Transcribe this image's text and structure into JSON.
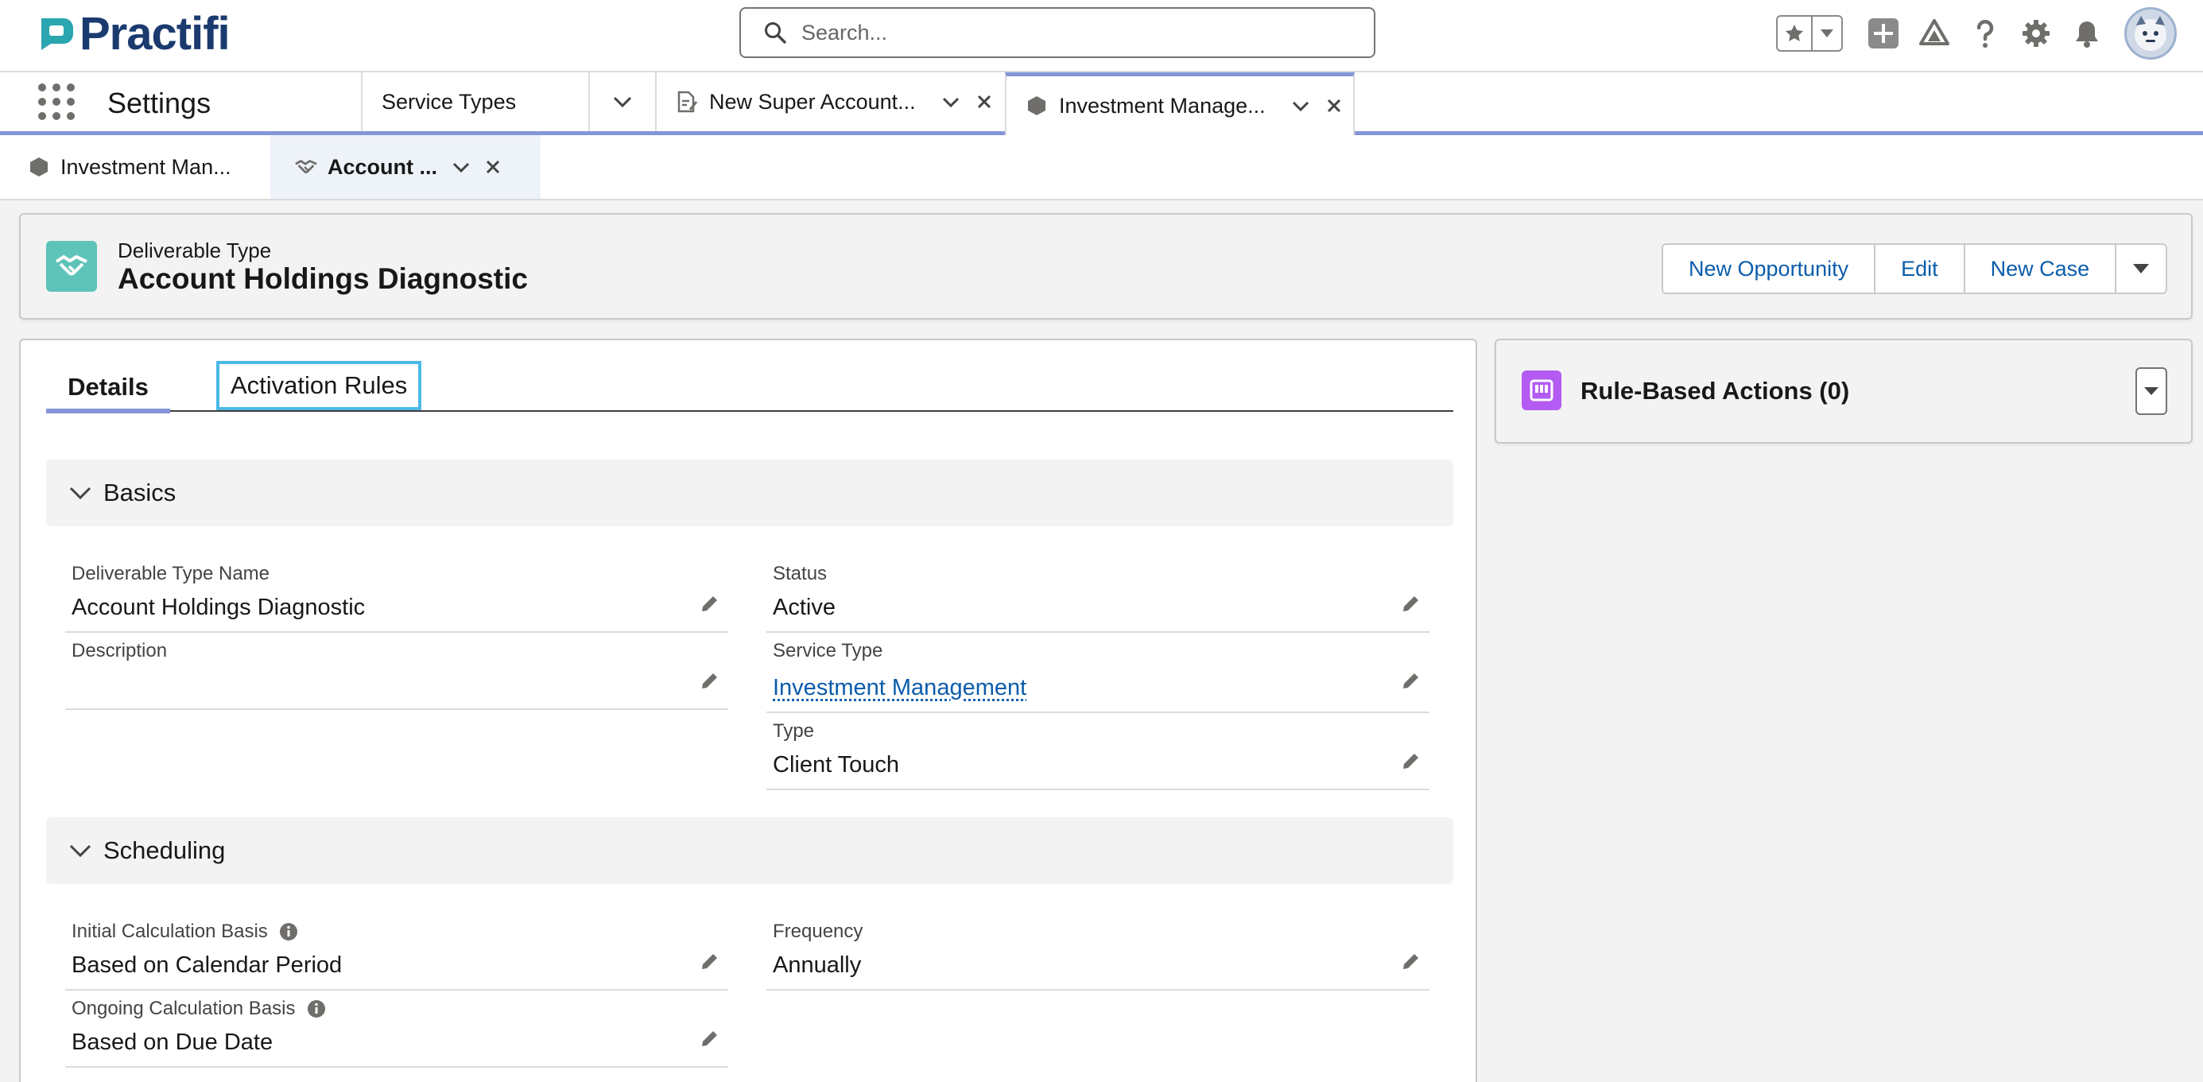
{
  "brand": {
    "name": "Practifi"
  },
  "search": {
    "placeholder": "Search..."
  },
  "header_icons": [
    "favorites-star-icon",
    "favorites-dropdown-icon",
    "global-actions-plus-icon",
    "trailhead-icon",
    "help-icon",
    "setup-gear-icon",
    "notifications-bell-icon",
    "user-avatar"
  ],
  "nav": {
    "app_name": "Settings",
    "tabs": [
      {
        "label": "Service Types"
      },
      {
        "label": "New Super Account..."
      },
      {
        "label": "Investment Manage..."
      }
    ]
  },
  "subtabs": [
    {
      "label": "Investment Man..."
    },
    {
      "label": "Account ..."
    }
  ],
  "record": {
    "object_type": "Deliverable Type",
    "title": "Account Holdings Diagnostic",
    "actions": {
      "new_opportunity": "New Opportunity",
      "edit": "Edit",
      "new_case": "New Case"
    }
  },
  "detail_tabs": {
    "details": "Details",
    "activation_rules": "Activation Rules"
  },
  "sections": {
    "basics": {
      "title": "Basics",
      "fields": {
        "name": {
          "label": "Deliverable Type Name",
          "value": "Account Holdings Diagnostic"
        },
        "status": {
          "label": "Status",
          "value": "Active"
        },
        "description": {
          "label": "Description",
          "value": ""
        },
        "service_type": {
          "label": "Service Type",
          "value": "Investment Management"
        },
        "type": {
          "label": "Type",
          "value": "Client Touch"
        }
      }
    },
    "scheduling": {
      "title": "Scheduling",
      "fields": {
        "initial_basis": {
          "label": "Initial Calculation Basis",
          "value": "Based on Calendar Period"
        },
        "frequency": {
          "label": "Frequency",
          "value": "Annually"
        },
        "ongoing_basis": {
          "label": "Ongoing Calculation Basis",
          "value": "Based on Due Date"
        }
      }
    }
  },
  "side_panel": {
    "title": "Rule-Based Actions (0)"
  },
  "colors": {
    "brand_navy": "#1b3b6f",
    "brand_teal": "#2aa6b0",
    "nav_accent": "#8496d9",
    "record_icon": "#5ec3b8",
    "rule_icon": "#b35bf2",
    "link": "#0b5cab",
    "focus_ring": "#4bb9e6"
  }
}
